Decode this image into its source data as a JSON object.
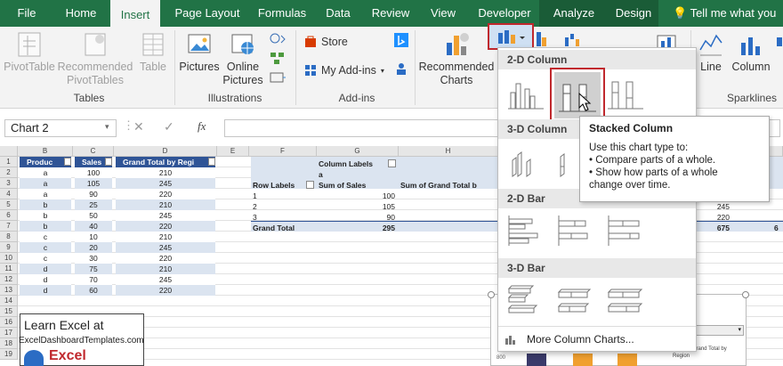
{
  "tabs": [
    "File",
    "Home",
    "Insert",
    "Page Layout",
    "Formulas",
    "Data",
    "Review",
    "View",
    "Developer",
    "Analyze",
    "Design"
  ],
  "tell_me": "Tell me what you w",
  "ribbon": {
    "pivot_table": "PivotTable",
    "recommended_pivot_1": "Recommended",
    "recommended_pivot_2": "PivotTables",
    "table": "Table",
    "pictures": "Pictures",
    "online_1": "Online",
    "online_2": "Pictures",
    "store": "Store",
    "my_addins": "My Add-ins",
    "rec_charts_1": "Recommended",
    "rec_charts_2": "Charts",
    "line": "Line",
    "column": "Column",
    "groups": {
      "tables": "Tables",
      "illustrations": "Illustrations",
      "addins": "Add-ins",
      "sparklines": "Sparklines"
    }
  },
  "name_box": "Chart 2",
  "fx": "fx",
  "columns": [
    "B",
    "C",
    "D",
    "E",
    "F",
    "G",
    "H"
  ],
  "rows": [
    "1",
    "2",
    "3",
    "4",
    "5",
    "6",
    "7",
    "8",
    "9",
    "10",
    "11",
    "12",
    "13",
    "14",
    "15",
    "16",
    "17",
    "18",
    "19"
  ],
  "table": {
    "headers": [
      "Produc",
      "Sales",
      "Grand Total by Regi"
    ],
    "rows": [
      [
        "a",
        "100",
        "210"
      ],
      [
        "a",
        "105",
        "245"
      ],
      [
        "a",
        "90",
        "220"
      ],
      [
        "b",
        "25",
        "210"
      ],
      [
        "b",
        "50",
        "245"
      ],
      [
        "b",
        "40",
        "220"
      ],
      [
        "c",
        "10",
        "210"
      ],
      [
        "c",
        "20",
        "245"
      ],
      [
        "c",
        "30",
        "220"
      ],
      [
        "d",
        "75",
        "210"
      ],
      [
        "d",
        "70",
        "245"
      ],
      [
        "d",
        "60",
        "220"
      ]
    ]
  },
  "pivot": {
    "column_labels": "Column Labels",
    "a": "a",
    "row_labels": "Row Labels",
    "sum_sales": "Sum of Sales",
    "sum_grand": "Sum of Grand Total b",
    "rows": [
      [
        "1",
        "100"
      ],
      [
        "2",
        "105"
      ],
      [
        "3",
        "90"
      ]
    ],
    "grand_total": "Grand Total",
    "grand_value": "295",
    "right_vals": [
      "245",
      "220"
    ],
    "right_total": "675",
    "right_edge": "6"
  },
  "promo": {
    "line1": "Learn Excel at",
    "line2": "ExcelDashboardTemplates.com",
    "logo": "Excel"
  },
  "dropdown": {
    "sections": [
      "2-D Column",
      "3-D Column",
      "2-D Bar",
      "3-D Bar"
    ],
    "more": "More Column Charts..."
  },
  "tooltip": {
    "title": "Stacked Column",
    "line1": "Use this chart type to:",
    "line2": "• Compare parts of a whole.",
    "line3": "• Show how parts of a whole",
    "line4": "change over time."
  },
  "chart_peek": {
    "axis": "800",
    "legend_1": "= Sum of Grand Total by",
    "legend_2": "Region"
  },
  "colors": {
    "excel_green": "#217346",
    "highlight_red": "#c0282d",
    "table_header": "#2f5496"
  }
}
